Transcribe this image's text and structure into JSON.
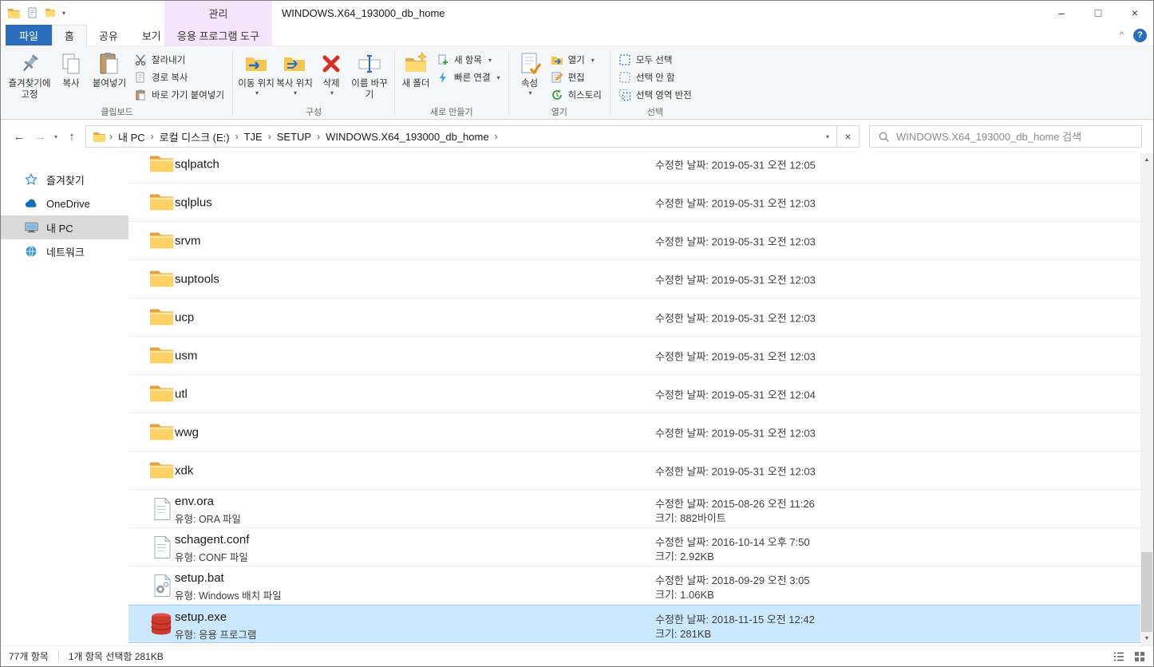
{
  "titlebar": {
    "manage_label": "관리",
    "title": "WINDOWS.X64_193000_db_home"
  },
  "glyphs": {
    "dropdown": "▾",
    "crumb_sep": "›",
    "back": "←",
    "forward": "→",
    "up": "↑",
    "clear": "×",
    "collapse": "^",
    "help": "?",
    "minimize": "–",
    "maximize": "□",
    "close": "×",
    "scroll_up": "▲",
    "scroll_down": "▼"
  },
  "tabs": {
    "file": "파일",
    "home": "홈",
    "share": "공유",
    "view": "보기",
    "app_tools": "응용 프로그램 도구"
  },
  "ribbon": {
    "clipboard": {
      "group_label": "클립보드",
      "pin": "즐겨찾기에 고정",
      "copy": "복사",
      "paste": "붙여넣기",
      "cut": "잘라내기",
      "copy_path": "경로 복사",
      "paste_shortcut": "바로 가기 붙여넣기"
    },
    "organize": {
      "group_label": "구성",
      "move_to": "이동 위치",
      "copy_to": "복사 위치",
      "delete": "삭제",
      "rename": "이름 바꾸기"
    },
    "new": {
      "group_label": "새로 만들기",
      "new_folder": "새 폴더",
      "new_item": "새 항목",
      "easy_access": "빠른 연결"
    },
    "open": {
      "group_label": "열기",
      "properties": "속성",
      "open": "열기",
      "edit": "편집",
      "history": "히스토리"
    },
    "select": {
      "group_label": "선택",
      "select_all": "모두 선택",
      "select_none": "선택 안 함",
      "invert": "선택 영역 반전"
    }
  },
  "address": {
    "crumbs": [
      "내 PC",
      "로컬 디스크 (E:)",
      "TJE",
      "SETUP",
      "WINDOWS.X64_193000_db_home"
    ],
    "search_placeholder": "WINDOWS.X64_193000_db_home 검색"
  },
  "sidebar": {
    "items": [
      {
        "label": "즐겨찾기"
      },
      {
        "label": "OneDrive"
      },
      {
        "label": "내 PC"
      },
      {
        "label": "네트워크"
      }
    ]
  },
  "files": [
    {
      "name": "sqlpatch",
      "date": "수정한 날짜: 2019-05-31 오전 12:05"
    },
    {
      "name": "sqlplus",
      "date": "수정한 날짜: 2019-05-31 오전 12:03"
    },
    {
      "name": "srvm",
      "date": "수정한 날짜: 2019-05-31 오전 12:03"
    },
    {
      "name": "suptools",
      "date": "수정한 날짜: 2019-05-31 오전 12:03"
    },
    {
      "name": "ucp",
      "date": "수정한 날짜: 2019-05-31 오전 12:03"
    },
    {
      "name": "usm",
      "date": "수정한 날짜: 2019-05-31 오전 12:03"
    },
    {
      "name": "utl",
      "date": "수정한 날짜: 2019-05-31 오전 12:04"
    },
    {
      "name": "wwg",
      "date": "수정한 날짜: 2019-05-31 오전 12:03"
    },
    {
      "name": "xdk",
      "date": "수정한 날짜: 2019-05-31 오전 12:03"
    },
    {
      "name": "env.ora",
      "type": "유형: ORA 파일",
      "date": "수정한 날짜: 2015-08-26 오전 11:26",
      "size": "크기: 882바이트"
    },
    {
      "name": "schagent.conf",
      "type": "유형: CONF 파일",
      "date": "수정한 날짜: 2016-10-14 오후 7:50",
      "size": "크기: 2.92KB"
    },
    {
      "name": "setup.bat",
      "type": "유형: Windows 배치 파일",
      "date": "수정한 날짜: 2018-09-29 오전 3:05",
      "size": "크기: 1.06KB"
    },
    {
      "name": "setup.exe",
      "type": "유형: 응용 프로그램",
      "date": "수정한 날짜: 2018-11-15 오전 12:42",
      "size": "크기: 281KB"
    }
  ],
  "statusbar": {
    "item_count": "77개 항목",
    "selection": "1개 항목 선택함 281KB"
  }
}
